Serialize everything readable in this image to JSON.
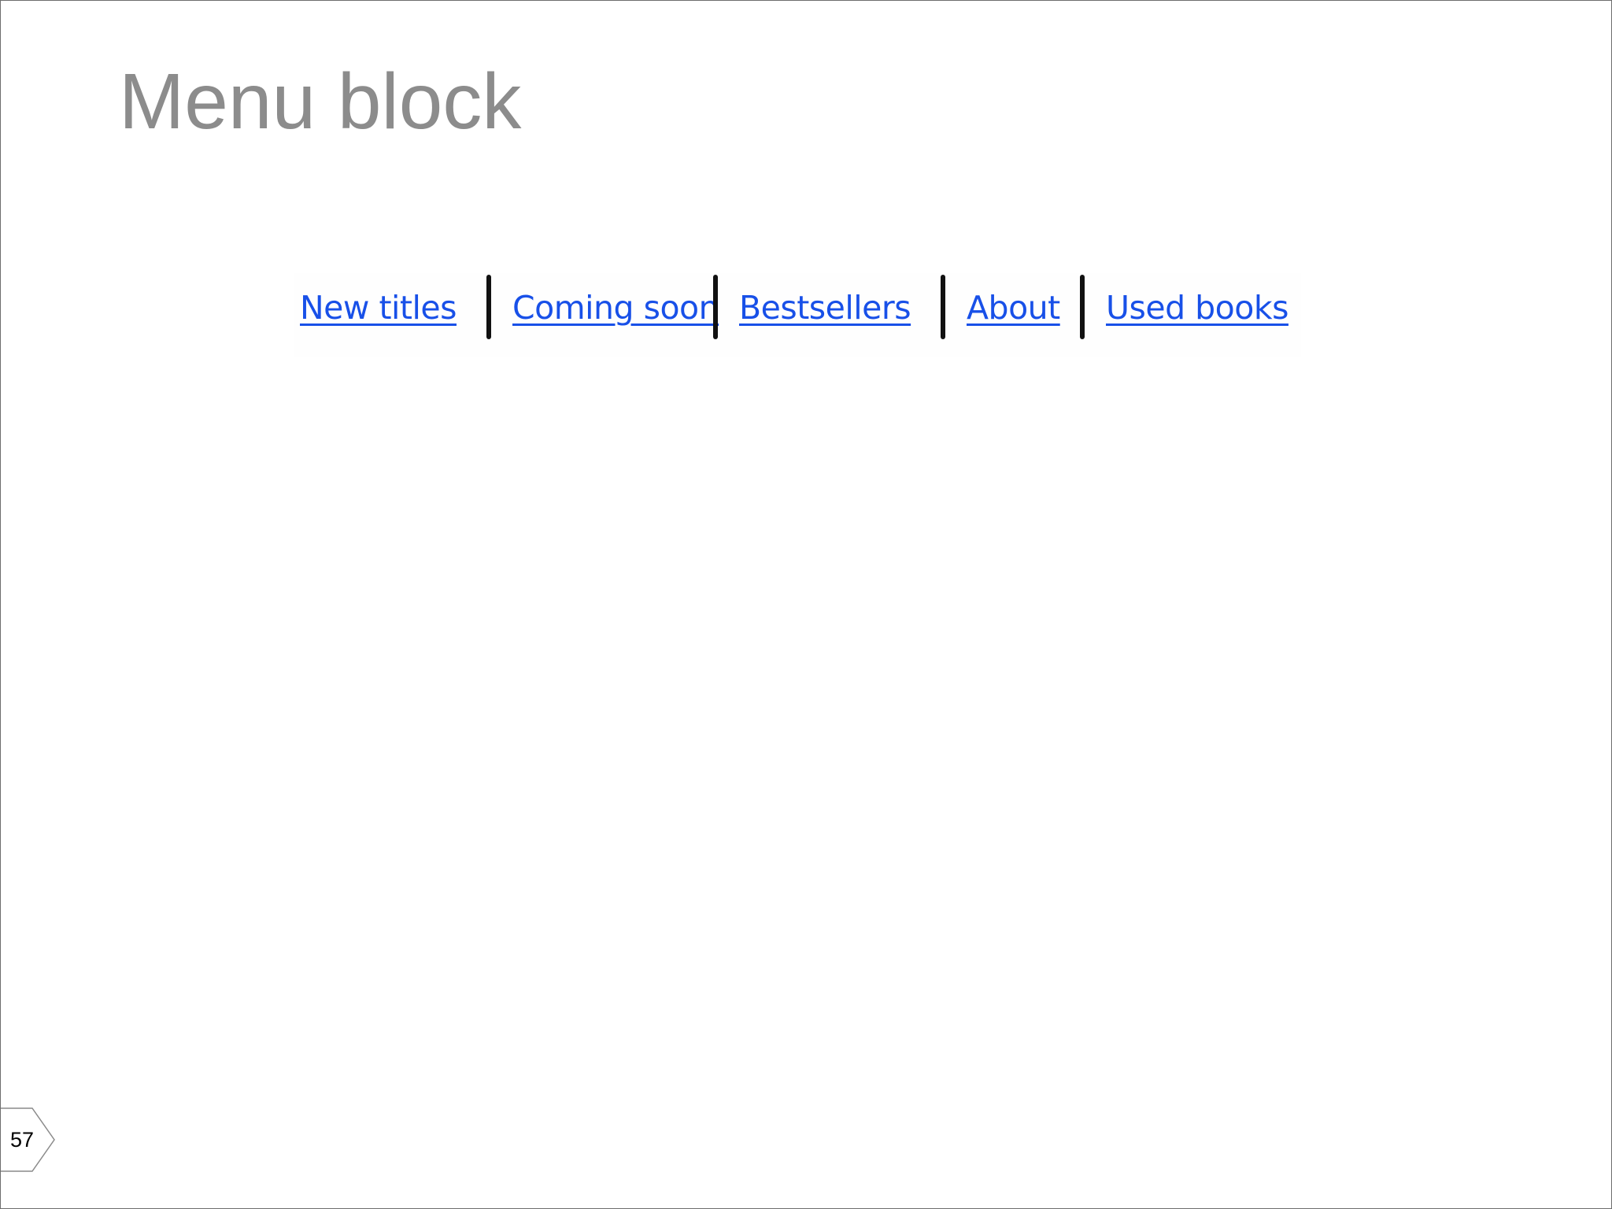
{
  "slide": {
    "title": "Menu block",
    "page_number": "57"
  },
  "menu": {
    "items": [
      {
        "label": "New titles"
      },
      {
        "label": "Coming soon"
      },
      {
        "label": "Bestsellers"
      },
      {
        "label": "About"
      },
      {
        "label": "Used books"
      }
    ],
    "separator_count": 4
  },
  "colors": {
    "title": "#8c8c8c",
    "link": "#1850e8",
    "separator": "#111111",
    "border": "#6e6e6e"
  }
}
